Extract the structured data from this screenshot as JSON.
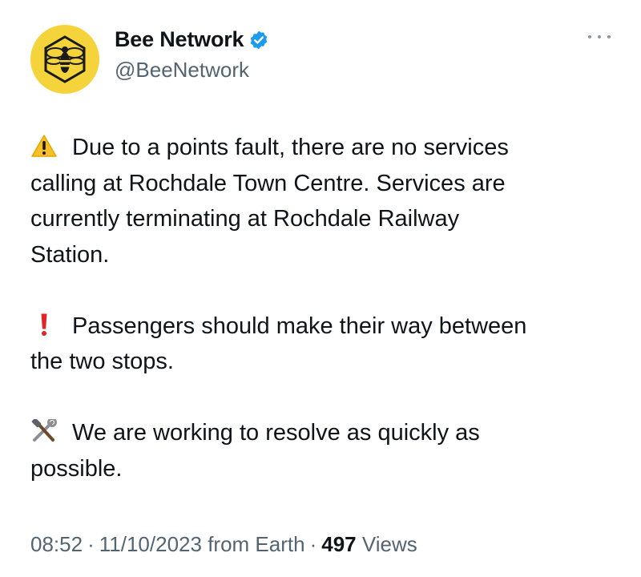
{
  "author": {
    "display_name": "Bee Network",
    "handle": "@BeeNetwork",
    "verified": true,
    "avatar_bg": "#f4d43a",
    "avatar_icon": "bee-logo-icon",
    "verified_color": "#1d9bf0"
  },
  "more_menu": {
    "icon": "more-options-icon"
  },
  "tweet": {
    "paragraphs": [
      {
        "emoji": "warning-icon",
        "lines": [
          "Due to a points fault, there are no services",
          "calling at Rochdale Town Centre. Services are",
          "currently terminating at Rochdale Railway",
          "Station."
        ]
      },
      {
        "emoji": "exclamation-icon",
        "lines": [
          "Passengers should make their way between",
          "the two stops."
        ]
      },
      {
        "emoji": "hammer-and-wrench-icon",
        "lines": [
          "We are working to resolve as quickly as",
          "possible."
        ]
      }
    ]
  },
  "meta": {
    "time": "08:52",
    "separator": "·",
    "date": "11/10/2023",
    "source": "from Earth",
    "views_count": "497",
    "views_label": "Views"
  }
}
